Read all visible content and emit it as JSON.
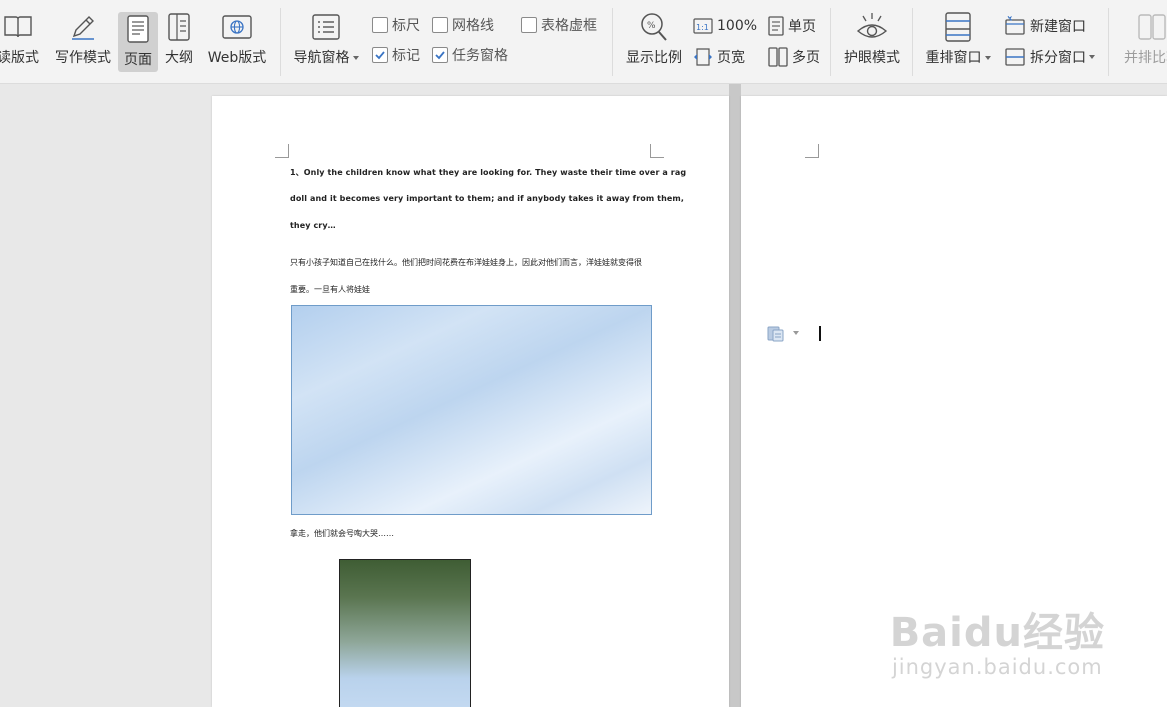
{
  "ribbon": {
    "read_mode": "读版式",
    "write_mode": "写作模式",
    "page": "页面",
    "outline": "大纲",
    "web_layout": "Web版式",
    "nav_pane": "导航窗格",
    "ruler": "标尺",
    "gridlines": "网格线",
    "table_gridlines": "表格虚框",
    "marks": "标记",
    "task_pane": "任务窗格",
    "zoom": "显示比例",
    "zoom_100": "100%",
    "page_width": "页宽",
    "single_page": "单页",
    "multi_page": "多页",
    "eye_mode": "护眼模式",
    "arrange_windows": "重排窗口",
    "new_window": "新建窗口",
    "split_window": "拆分窗口",
    "side_by_side": "并排比较"
  },
  "checkboxes": {
    "ruler_checked": false,
    "gridlines_checked": false,
    "table_gridlines_checked": false,
    "marks_checked": true,
    "task_pane_checked": true
  },
  "document": {
    "en_line1": "1、Only the children know what they are looking for. They waste their time over a rag",
    "en_line2": "doll and it becomes very important to them; and if anybody takes it away from them,",
    "en_line3": "they cry…",
    "zh_line1": "只有小孩子知道自己在找什么。他们把时间花费在布洋娃娃身上，因此对他们而言，洋娃娃就变得很",
    "zh_line2": "重要。一旦有人将娃娃",
    "zh_line3": "拿走，他们就会号啕大哭……"
  },
  "watermark": {
    "logo": "Baidu经验",
    "sub": "jingyan.baidu.com"
  },
  "colors": {
    "ribbon_bg": "#f3f3f3",
    "workspace_bg": "#e8e8e8",
    "accent_blue": "#3a74c4"
  }
}
